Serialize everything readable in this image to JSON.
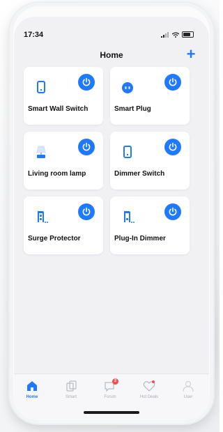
{
  "status_bar": {
    "time": "17:34"
  },
  "header": {
    "title": "Home",
    "add_label": "+"
  },
  "devices": [
    {
      "name": "Smart Wall Switch",
      "icon": "wall-switch-icon"
    },
    {
      "name": "Smart Plug",
      "icon": "smart-plug-icon"
    },
    {
      "name": "Living room lamp",
      "icon": "lamp-icon"
    },
    {
      "name": "Dimmer Switch",
      "icon": "dimmer-switch-icon"
    },
    {
      "name": "Surge Protector",
      "icon": "surge-protector-icon"
    },
    {
      "name": "Plug-In Dimmer",
      "icon": "plug-in-dimmer-icon"
    }
  ],
  "tabs": [
    {
      "label": "Home",
      "icon": "home-icon",
      "active": true
    },
    {
      "label": "Smart",
      "icon": "smart-icon",
      "active": false
    },
    {
      "label": "Forum",
      "icon": "forum-icon",
      "active": false,
      "badge": "2"
    },
    {
      "label": "Hot Deals",
      "icon": "hot-deals-icon",
      "active": false
    },
    {
      "label": "User",
      "icon": "user-icon",
      "active": false
    }
  ],
  "colors": {
    "accent": "#1e79ff",
    "background": "#f1f1f4",
    "card": "#ffffff",
    "badge": "#f0504f",
    "inactive_tab": "#a8adb5"
  }
}
